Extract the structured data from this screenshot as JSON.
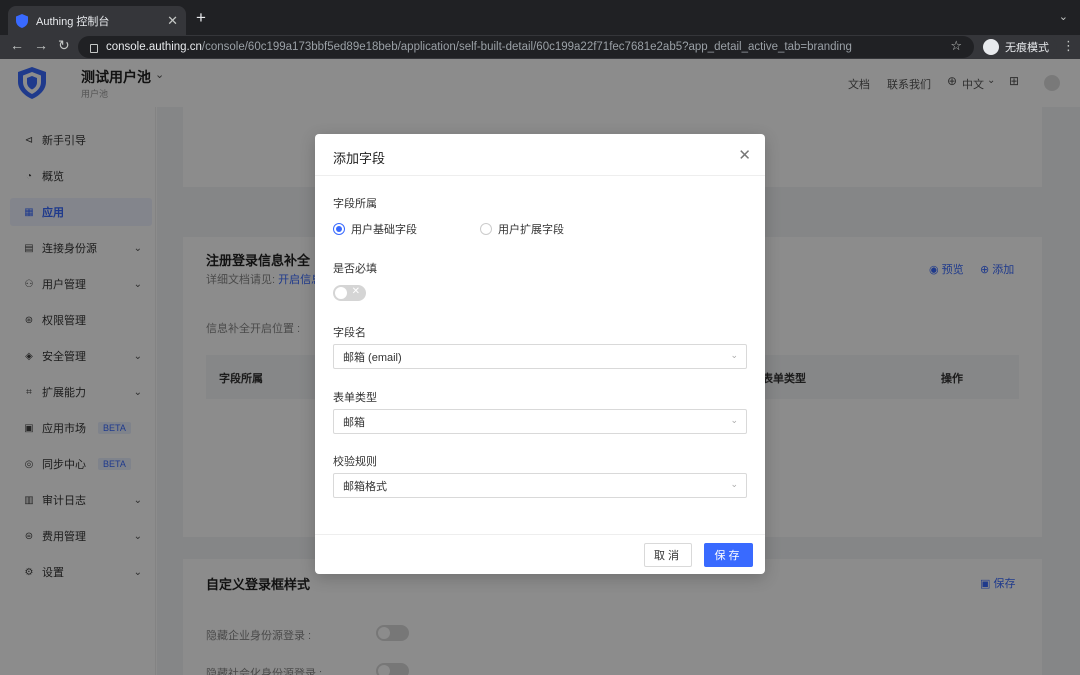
{
  "browser": {
    "tab_title": "Authing 控制台",
    "url_host": "console.authing.cn",
    "url_path": "/console/60c199a173bbf5ed89e18beb/application/self-built-detail/60c199a22f71fec7681e2ab5?app_detail_active_tab=branding",
    "incognito_label": "无痕模式"
  },
  "header": {
    "pool_name": "测试用户池",
    "pool_subtitle": "用户池",
    "docs": "文档",
    "contact": "联系我们",
    "language": "中文"
  },
  "sidebar": {
    "items": [
      {
        "label": "新手引导",
        "icon": "send-icon",
        "glyph": "⊲"
      },
      {
        "label": "概览",
        "icon": "dashboard-icon",
        "glyph": "◔"
      },
      {
        "label": "应用",
        "icon": "apps-icon",
        "glyph": "▦"
      },
      {
        "label": "连接身份源",
        "icon": "identity-icon",
        "glyph": "▤"
      },
      {
        "label": "用户管理",
        "icon": "user-icon",
        "glyph": "⚇"
      },
      {
        "label": "权限管理",
        "icon": "permission-icon",
        "glyph": "⊛"
      },
      {
        "label": "安全管理",
        "icon": "shield-icon",
        "glyph": "◈"
      },
      {
        "label": "扩展能力",
        "icon": "extension-icon",
        "glyph": "⌗"
      },
      {
        "label": "应用市场",
        "icon": "market-icon",
        "glyph": "▣",
        "badge": "BETA"
      },
      {
        "label": "同步中心",
        "icon": "sync-icon",
        "glyph": "◎",
        "badge": "BETA"
      },
      {
        "label": "审计日志",
        "icon": "log-icon",
        "glyph": "▥"
      },
      {
        "label": "费用管理",
        "icon": "billing-icon",
        "glyph": "⊜"
      },
      {
        "label": "设置",
        "icon": "settings-icon",
        "glyph": "⚙"
      }
    ]
  },
  "background": {
    "section1_title": "注册登录信息补全",
    "section1_sub": "详细文档请见: ",
    "section1_link": "开启信息",
    "preview": "预览",
    "add": "添加",
    "trigger_label": "信息补全开启位置 :",
    "col_belong": "字段所属",
    "col_form": "表单类型",
    "col_ops": "操作",
    "section2_title": "自定义登录框样式",
    "save": "保存",
    "hide_enterprise": "隐藏企业身份源登录 :",
    "hide_social": "隐藏社会化身份源登录 :"
  },
  "modal": {
    "title": "添加字段",
    "belong_label": "字段所属",
    "radio_basic": "用户基础字段",
    "radio_extend": "用户扩展字段",
    "required_label": "是否必填",
    "required_value": false,
    "field_label": "字段名",
    "field_value": "邮箱 (email)",
    "form_type_label": "表单类型",
    "form_type_value": "邮箱",
    "rule_label": "校验规则",
    "rule_value": "邮箱格式",
    "cancel": "取消",
    "save": "保存"
  },
  "colors": {
    "primary": "#396aff",
    "overlay": "rgba(0,0,0,0.45)"
  }
}
